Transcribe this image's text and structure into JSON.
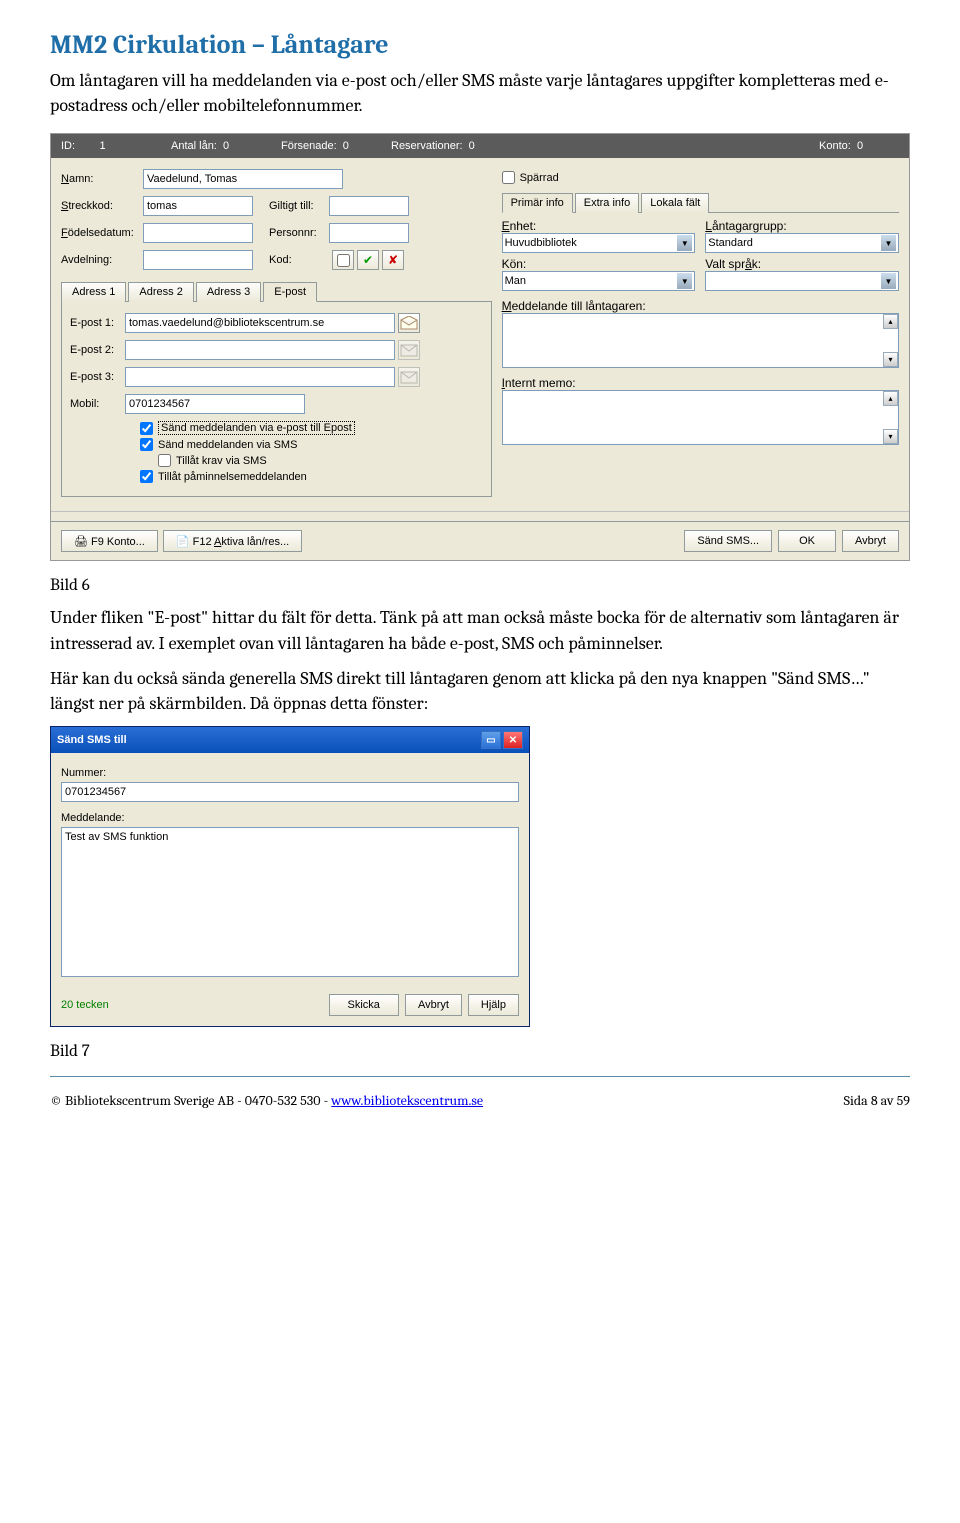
{
  "doc": {
    "title": "MM2 Cirkulation – Låntagare",
    "para1": "Om låntagaren vill ha meddelanden via e-post och/eller SMS måste varje låntagares uppgifter kompletteras med e-postadress och/eller mobiltelefonnummer.",
    "caption1": "Bild 6",
    "para2": "Under fliken \"E-post\" hittar du fält för detta. Tänk på att man också måste bocka för de alternativ som låntagaren är intresserad av. I exemplet ovan vill låntagaren ha både e-post, SMS och påminnelser.",
    "para3": "Här kan du också sända generella SMS direkt till låntagaren genom att klicka på den nya knappen \"Sänd SMS…\" längst ner på skärmbilden. Då öppnas detta fönster:",
    "caption2": "Bild 7",
    "footer_left": "© Bibliotekscentrum Sverige AB - 0470-532 530 - ",
    "footer_link": "www.bibliotekscentrum.se",
    "footer_right": "Sida 8 av 59"
  },
  "s1": {
    "hdr": {
      "id_lbl": "ID:",
      "id": "1",
      "antal_lbl": "Antal lån:",
      "antal": "0",
      "fors_lbl": "Försenade:",
      "fors": "0",
      "res_lbl": "Reservationer:",
      "res": "0",
      "kon_lbl": "Konto:",
      "kon": "0"
    },
    "left": {
      "namn_lbl": "Namn:",
      "namn": "Vaedelund, Tomas",
      "sparrad": "Spärrad",
      "streck_lbl": "Streckkod:",
      "streck": "tomas",
      "giltigt_lbl": "Giltigt till:",
      "giltigt": "",
      "fodelse_lbl": "Födelsedatum:",
      "fodelse": "",
      "personnr_lbl": "Personnr:",
      "personnr": "",
      "avdelning_lbl": "Avdelning:",
      "avdelning": "",
      "kod_lbl": "Kod:",
      "kod": "",
      "tab1": "Adress 1",
      "tab2": "Adress 2",
      "tab3": "Adress 3",
      "tab4": "E-post",
      "ep1_lbl": "E-post 1:",
      "ep1": "tomas.vaedelund@bibliotekscentrum.se",
      "ep2_lbl": "E-post 2:",
      "ep2": "",
      "ep3_lbl": "E-post 3:",
      "ep3": "",
      "mobil_lbl": "Mobil:",
      "mobil": "0701234567",
      "cb1": "Sänd meddelanden via e-post till Epost",
      "cb2": "Sänd meddelanden via SMS",
      "cb3": "Tillåt krav via SMS",
      "cb4": "Tillåt påminnelsemeddelanden"
    },
    "right": {
      "tab1": "Primär info",
      "tab2": "Extra info",
      "tab3": "Lokala fält",
      "enhet_lbl": "Enhet:",
      "enhet": "Huvudbibliotek",
      "grupp_lbl": "Låntagargrupp:",
      "grupp": "Standard",
      "kon_lbl": "Kön:",
      "kon": "Man",
      "sprak_lbl": "Valt språk:",
      "sprak": "",
      "medd_lbl": "Meddelande till låntagaren:",
      "memo_lbl": "Internt memo:"
    },
    "btm": {
      "f9": "F9 Konto...",
      "f12": "F12 Aktiva lån/res...",
      "sms": "Sänd SMS...",
      "ok": "OK",
      "avbryt": "Avbryt"
    }
  },
  "s2": {
    "title": "Sänd SMS till",
    "nummer_lbl": "Nummer:",
    "nummer": "0701234567",
    "medd_lbl": "Meddelande:",
    "medd": "Test av SMS funktion",
    "counter": "20 tecken",
    "skicka": "Skicka",
    "avbryt": "Avbryt",
    "hjalp": "Hjälp"
  }
}
